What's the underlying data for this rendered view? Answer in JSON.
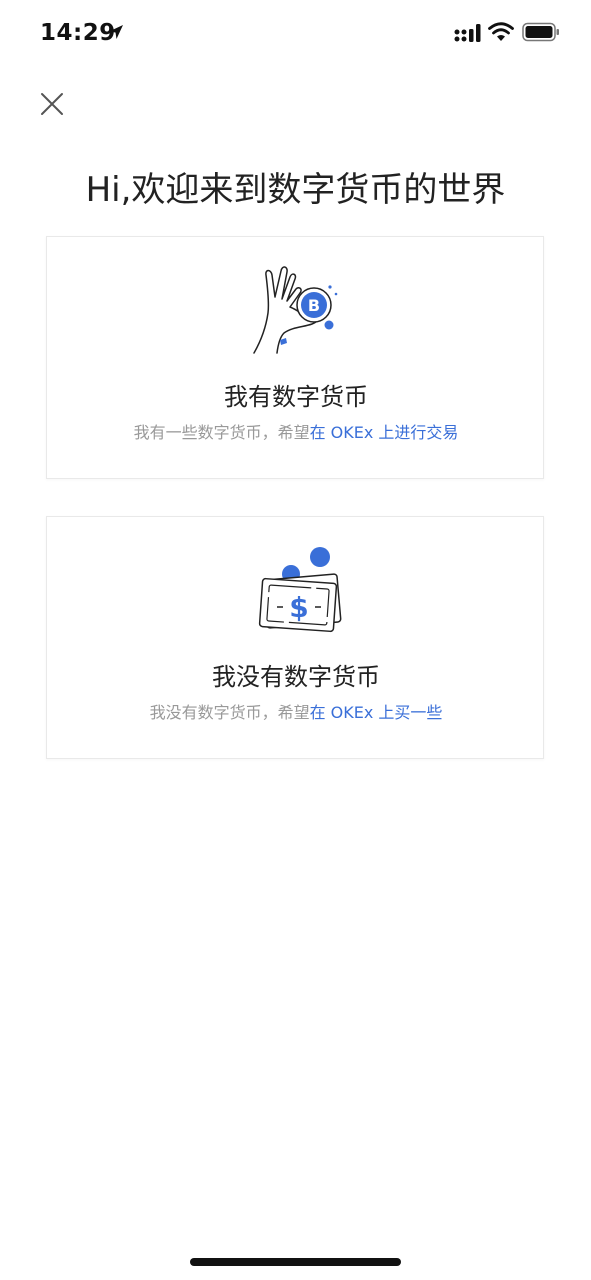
{
  "status_bar": {
    "time": "14:29"
  },
  "title": "Hi,欢迎来到数字货币的世界",
  "cards": [
    {
      "title": "我有数字货币",
      "desc_plain": "我有一些数字货币，希望",
      "desc_link": "在 OKEx 上进行交易"
    },
    {
      "title": "我没有数字货币",
      "desc_plain": "我没有数字货币，希望",
      "desc_link": "在 OKEx 上买一些"
    }
  ],
  "colors": {
    "accent": "#3a6fd8",
    "text": "#222222",
    "muted": "#999999"
  },
  "icons": {
    "close": "close-icon",
    "card1": "hand-holding-bitcoin-icon",
    "card2": "dollar-bill-icon"
  }
}
